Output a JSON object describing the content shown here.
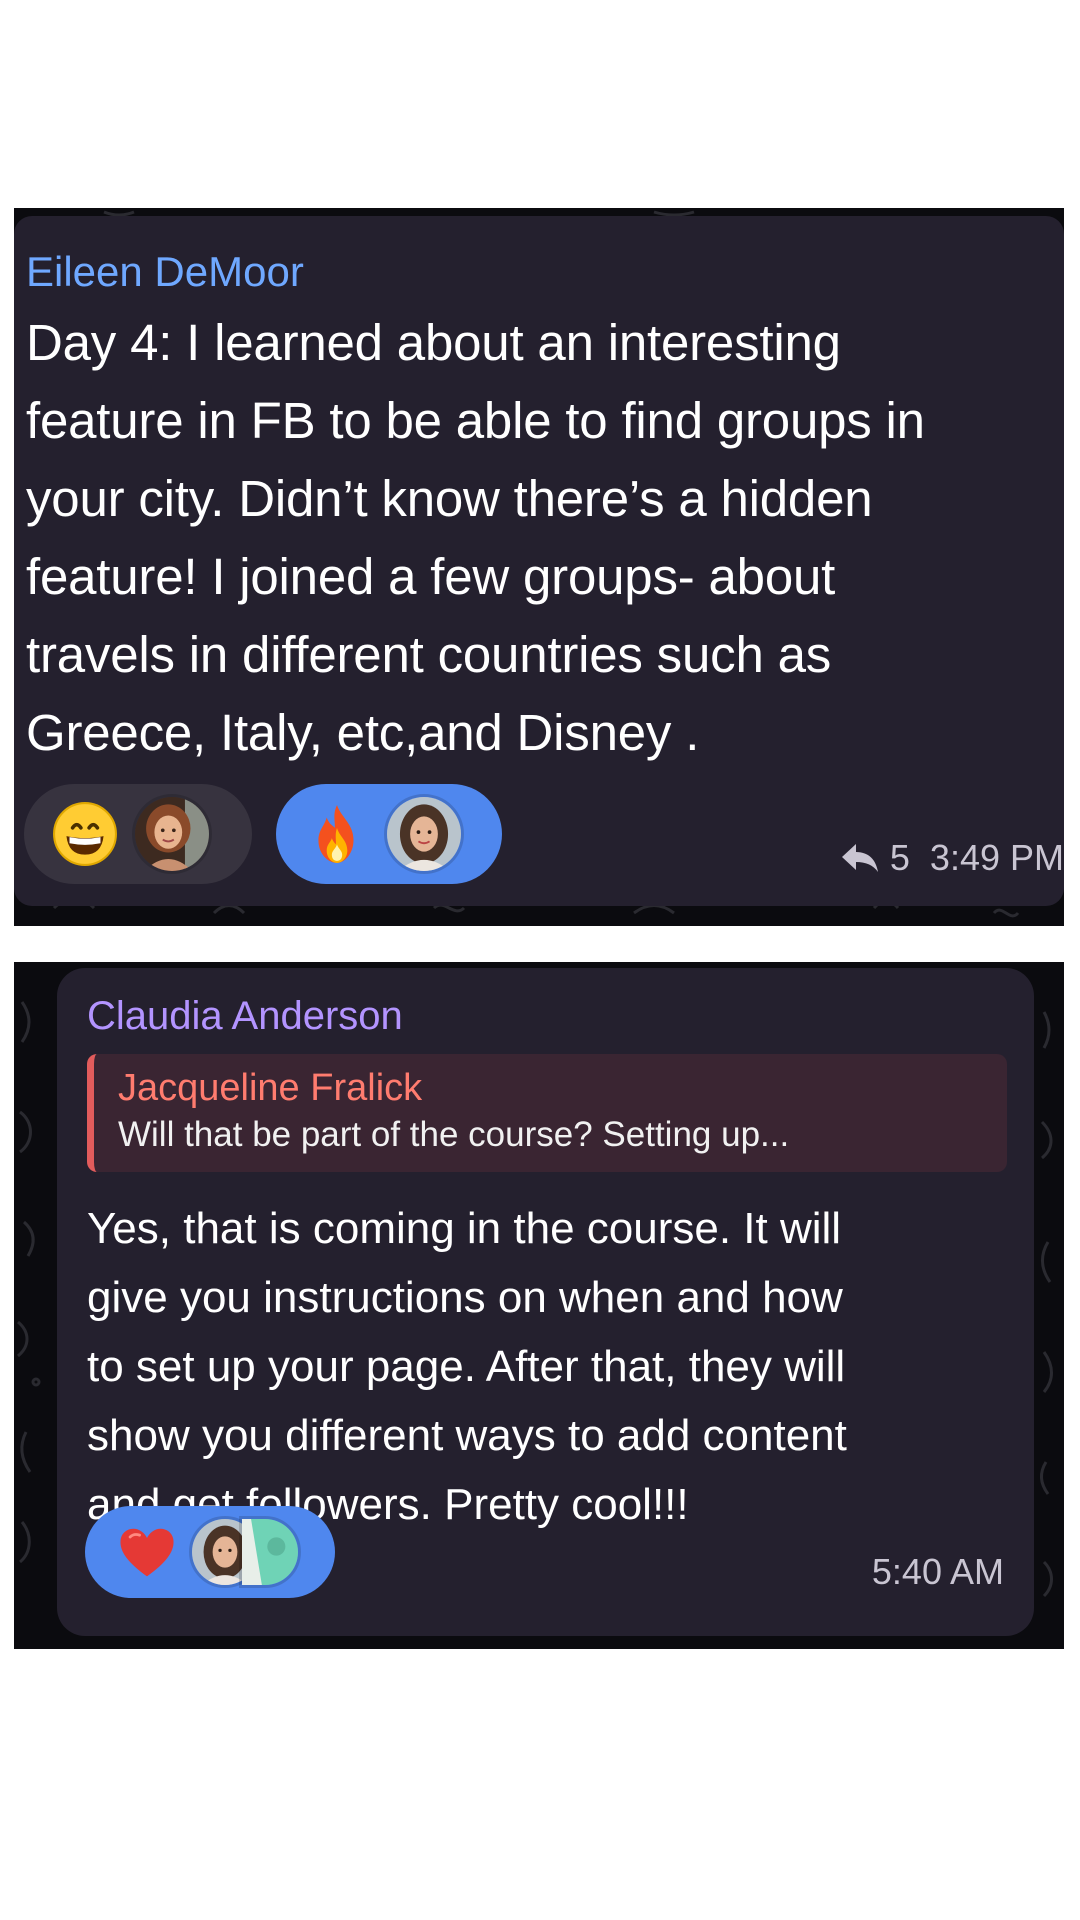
{
  "messages": [
    {
      "sender": "Eileen DeMoor",
      "sender_color": "#6fa8ff",
      "lines": [
        "Day 4: I learned about an interesting",
        "feature in FB to be able to find groups in",
        "your city. Didn’t know there’s a hidden",
        "feature! I joined a few groups- about",
        "travels in different countries such as",
        "Greece, Italy, etc,and Disney ."
      ],
      "reactions": [
        {
          "emoji": "grinning-face-emoji",
          "avatars": [
            "avatar-woman-short-hair"
          ],
          "style": "dark"
        },
        {
          "emoji": "fire-emoji",
          "avatars": [
            "avatar-woman-long-hair"
          ],
          "style": "blue"
        }
      ],
      "reply_count": "5",
      "time": "3:49 PM"
    },
    {
      "sender": "Claudia Anderson",
      "sender_color": "#b394ff",
      "reply_to": {
        "name": "Jacqueline Fralick",
        "text": "Will that be part of the course? Setting up..."
      },
      "lines": [
        "Yes, that is coming in the course. It will",
        "give you instructions on when and how",
        "to set up your page. After that, they will",
        "show you different ways to add content",
        "and get followers. Pretty cool!!!"
      ],
      "reactions": [
        {
          "emoji": "red-heart-emoji",
          "avatars": [
            "avatar-woman-long-hair",
            "avatar-teal"
          ],
          "style": "blue"
        }
      ],
      "time": "5:40 AM"
    }
  ],
  "colors": {
    "bubble": "#24202e",
    "reaction_blue": "#4f87ee",
    "reaction_dark": "#37333f",
    "reply_accent": "#e25c5c"
  }
}
